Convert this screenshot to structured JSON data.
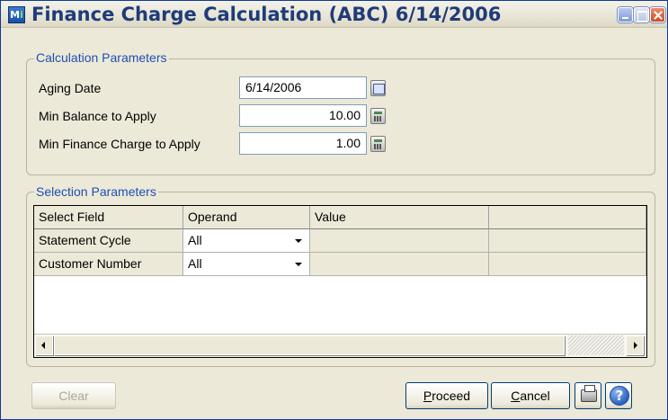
{
  "window": {
    "title": "Finance Charge Calculation (ABC) 6/14/2006",
    "app_icon_letters": [
      "M",
      "i"
    ]
  },
  "calculation_parameters": {
    "legend": "Calculation Parameters",
    "aging_date": {
      "label": "Aging Date",
      "value": "6/14/2006",
      "icon": "calendar-icon"
    },
    "min_balance": {
      "label": "Min Balance to Apply",
      "value": "10.00",
      "icon": "calculator-icon"
    },
    "min_finance_charge": {
      "label": "Min Finance Charge to Apply",
      "value": "1.00",
      "icon": "calculator-icon"
    }
  },
  "selection_parameters": {
    "legend": "Selection Parameters",
    "columns": [
      "Select Field",
      "Operand",
      "Value",
      ""
    ],
    "rows": [
      {
        "select_field": "Statement Cycle",
        "operand": "All",
        "value": ""
      },
      {
        "select_field": "Customer Number",
        "operand": "All",
        "value": ""
      }
    ]
  },
  "buttons": {
    "clear": {
      "label": "Clear",
      "enabled": false
    },
    "proceed": {
      "label_prefix": "",
      "label_mnemonic": "P",
      "label_rest": "roceed"
    },
    "cancel": {
      "label_prefix": "",
      "label_mnemonic": "C",
      "label_rest": "ancel"
    },
    "print_icon": "printer-icon",
    "help_icon": "help-icon",
    "help_glyph": "?"
  },
  "colors": {
    "title_text": "#1f3c7a",
    "legend_text": "#1f4fb4",
    "window_bg": "#ece9d8"
  }
}
